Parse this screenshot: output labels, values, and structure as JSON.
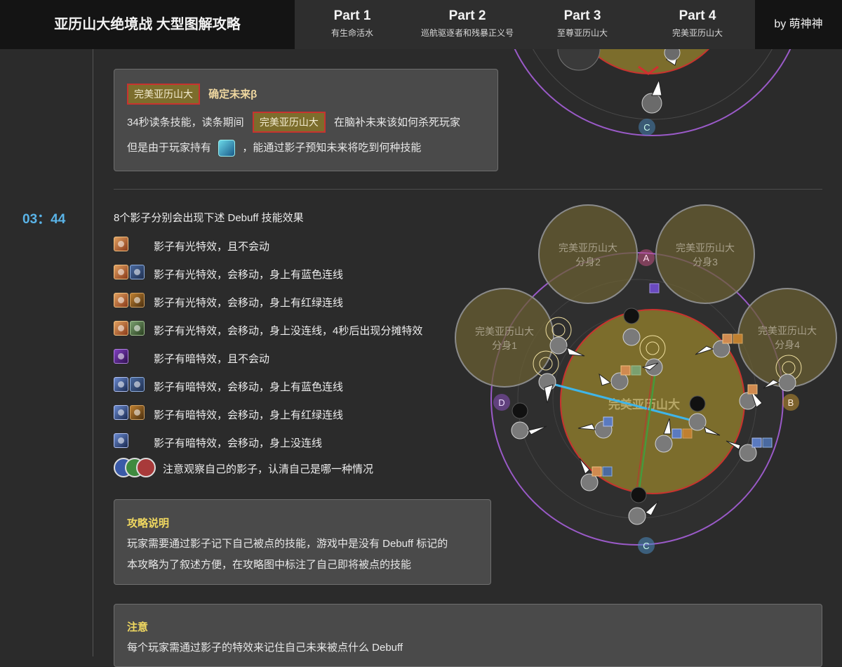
{
  "header": {
    "title": "亚历山大绝境战 大型图解攻略",
    "parts": [
      {
        "title": "Part 1",
        "subtitle": "有生命活水"
      },
      {
        "title": "Part 2",
        "subtitle": "巡航驱逐者和残暴正义号"
      },
      {
        "title": "Part 3",
        "subtitle": "至尊亚历山大"
      },
      {
        "title": "Part 4",
        "subtitle": "完美亚历山大"
      }
    ],
    "author": "by 萌神神"
  },
  "skill_box": {
    "boss_tag": "完美亚历山大",
    "skill_name": "确定未来β",
    "line1_before": "34秒读条技能，读条期间",
    "line1_after": "在脑补未来该如何杀死玩家",
    "line2_before": "但是由于玩家持有",
    "line2_after": "，能通过影子预知未来将吃到何种技能"
  },
  "timeline": {
    "time": "03：44"
  },
  "debuff_list": {
    "header": "8个影子分别会出现下述 Debuff 技能效果",
    "items": [
      {
        "text": "影子有光特效，且不会动",
        "icons": [
          "i-light"
        ]
      },
      {
        "text": "影子有光特效，会移动，身上有蓝色连线",
        "icons": [
          "i-light",
          "i-blue"
        ]
      },
      {
        "text": "影子有光特效，会移动，身上有红绿连线",
        "icons": [
          "i-light",
          "i-rg"
        ]
      },
      {
        "text": "影子有光特效，会移动，身上没连线，4秒后出现分摊特效",
        "icons": [
          "i-light",
          "i-stack"
        ]
      },
      {
        "text": "影子有暗特效，且不会动",
        "icons": [
          "i-dark-solo"
        ]
      },
      {
        "text": "影子有暗特效，会移动，身上有蓝色连线",
        "icons": [
          "i-dark2",
          "i-blue"
        ]
      },
      {
        "text": "影子有暗特效，会移动，身上有红绿连线",
        "icons": [
          "i-dark2",
          "i-rg"
        ]
      },
      {
        "text": "影子有暗特效，会移动，身上没连线",
        "icons": [
          "i-dark2"
        ]
      }
    ],
    "roles_note": "注意观察自己的影子，认清自己是哪一种情况",
    "role_colors": [
      "#3a5aa8",
      "#3f8a3f",
      "#a83a3a"
    ]
  },
  "guide_box": {
    "title": "攻略说明",
    "line1": "玩家需要通过影子记下自己被点的技能，游戏中是没有 Debuff 标记的",
    "line2": "本攻略为了叙述方便，在攻略图中标注了自己即将被点的技能"
  },
  "note_box": {
    "title": "注意",
    "line1": "每个玩家需通过影子的特效来记住自己未来被点什么 Debuff"
  },
  "diagram": {
    "boss_label": "完美亚历山大",
    "clones": [
      "完美亚历山大\n分身1",
      "完美亚历山大\n分身2",
      "完美亚历山大\n分身3",
      "完美亚历山大\n分身4"
    ],
    "waymarks": [
      "A",
      "B",
      "C",
      "D"
    ],
    "waymark_colors": {
      "A": "#c05080",
      "B": "#c09030",
      "C": "#4a8ac0",
      "D": "#8a50c0"
    },
    "colors": {
      "arena": "#9a5ac8",
      "boss_fill": "#7c6d2c",
      "boss_ring": "#c8332f",
      "tether_blue": "#3fb5e8",
      "tether_green": "#3fa03f"
    }
  }
}
